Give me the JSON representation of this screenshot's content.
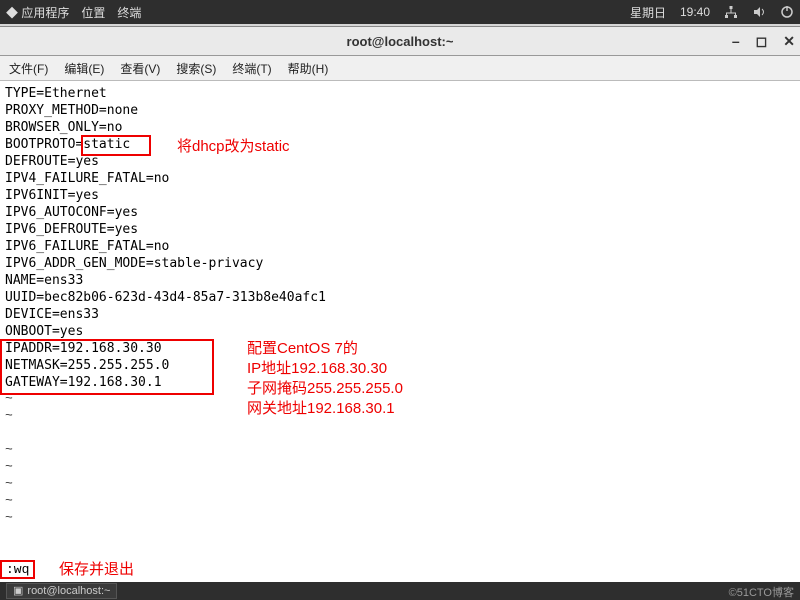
{
  "panel": {
    "apps": "应用程序",
    "places": "位置",
    "terminal": "终端",
    "day": "星期日",
    "time": "19:40"
  },
  "window": {
    "title": "root@localhost:~"
  },
  "menu": {
    "file": "文件(F)",
    "edit": "编辑(E)",
    "view": "查看(V)",
    "search": "搜索(S)",
    "terminal": "终端(T)",
    "help": "帮助(H)"
  },
  "cfg": {
    "l01": "TYPE=Ethernet",
    "l02": "PROXY_METHOD=none",
    "l03": "BROWSER_ONLY=no",
    "l04a": "BOOTPROTO=",
    "l04b": "static",
    "l05": "DEFROUTE=yes",
    "l06": "IPV4_FAILURE_FATAL=no",
    "l07": "IPV6INIT=yes",
    "l08": "IPV6_AUTOCONF=yes",
    "l09": "IPV6_DEFROUTE=yes",
    "l10": "IPV6_FAILURE_FATAL=no",
    "l11": "IPV6_ADDR_GEN_MODE=stable-privacy",
    "l12": "NAME=ens33",
    "l13": "UUID=bec82b06-623d-43d4-85a7-313b8e40afc1",
    "l14": "DEVICE=ens33",
    "l15": "ONBOOT=yes",
    "l16": "IPADDR=192.168.30.30",
    "l17": "NETMASK=255.255.255.0",
    "l18": "GATEWAY=192.168.30.1"
  },
  "notes": {
    "static": "将dhcp改为static",
    "ip": "配置CentOS 7的\nIP地址192.168.30.30\n子网掩码255.255.255.0\n网关地址192.168.30.1",
    "wq": "保存并退出"
  },
  "vim": {
    "wq": ":wq"
  },
  "taskbar": {
    "title": "root@localhost:~"
  },
  "watermark": "©51CTO博客"
}
